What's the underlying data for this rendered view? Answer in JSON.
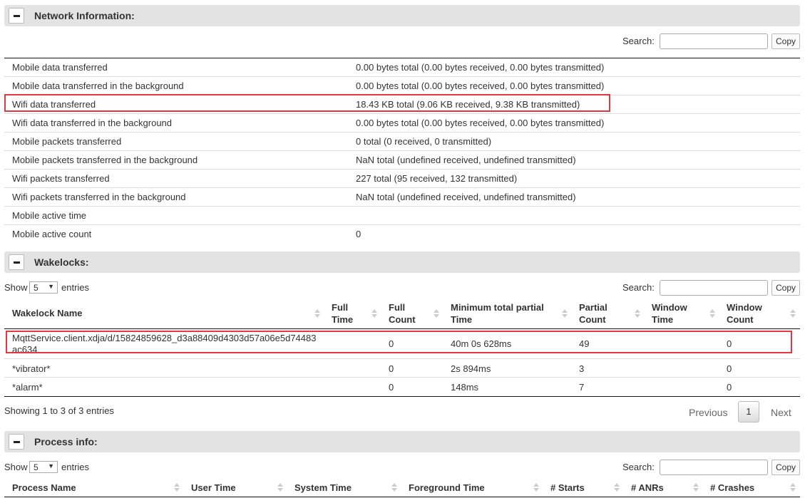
{
  "network": {
    "title": "Network Information:",
    "search_label": "Search:",
    "copy_label": "Copy",
    "rows": [
      {
        "label": "Mobile data transferred",
        "value": "0.00 bytes total (0.00 bytes received, 0.00 bytes transmitted)"
      },
      {
        "label": "Mobile data transferred in the background",
        "value": "0.00 bytes total (0.00 bytes received, 0.00 bytes transmitted)"
      },
      {
        "label": "Wifi data transferred",
        "value": "18.43 KB total (9.06 KB received, 9.38 KB transmitted)"
      },
      {
        "label": "Wifi data transferred in the background",
        "value": "0.00 bytes total (0.00 bytes received, 0.00 bytes transmitted)"
      },
      {
        "label": "Mobile packets transferred",
        "value": "0 total (0 received, 0 transmitted)"
      },
      {
        "label": "Mobile packets transferred in the background",
        "value": "NaN total (undefined received, undefined transmitted)"
      },
      {
        "label": "Wifi packets transferred",
        "value": "227 total (95 received, 132 transmitted)"
      },
      {
        "label": "Wifi packets transferred in the background",
        "value": "NaN total (undefined received, undefined transmitted)"
      },
      {
        "label": "Mobile active time",
        "value": ""
      },
      {
        "label": "Mobile active count",
        "value": "0"
      }
    ]
  },
  "wakelocks": {
    "title": "Wakelocks:",
    "show_label": "Show",
    "show_value": "5",
    "entries_label": "entries",
    "search_label": "Search:",
    "copy_label": "Copy",
    "columns": [
      "Wakelock Name",
      "Full Time",
      "Full Count",
      "Minimum total partial Time",
      "Partial Count",
      "Window Time",
      "Window Count"
    ],
    "rows": [
      {
        "name": "MqttService.client.xdjа/d/15824859628_d3a88409d4303d57a06e5d74483ac634",
        "full_time": "",
        "full_count": "0",
        "min_partial": "40m 0s 628ms",
        "partial_count": "49",
        "window_time": "",
        "window_count": "0"
      },
      {
        "name": "*vibrator*",
        "full_time": "",
        "full_count": "0",
        "min_partial": "2s 894ms",
        "partial_count": "3",
        "window_time": "",
        "window_count": "0"
      },
      {
        "name": "*alarm*",
        "full_time": "",
        "full_count": "0",
        "min_partial": "148ms",
        "partial_count": "7",
        "window_time": "",
        "window_count": "0"
      }
    ],
    "info": "Showing 1 to 3 of 3 entries",
    "previous": "Previous",
    "current_page": "1",
    "next": "Next"
  },
  "process": {
    "title": "Process info:",
    "show_label": "Show",
    "show_value": "5",
    "entries_label": "entries",
    "search_label": "Search:",
    "copy_label": "Copy",
    "columns": [
      "Process Name",
      "User Time",
      "System Time",
      "Foreground Time",
      "# Starts",
      "# ANRs",
      "# Crashes"
    ]
  }
}
